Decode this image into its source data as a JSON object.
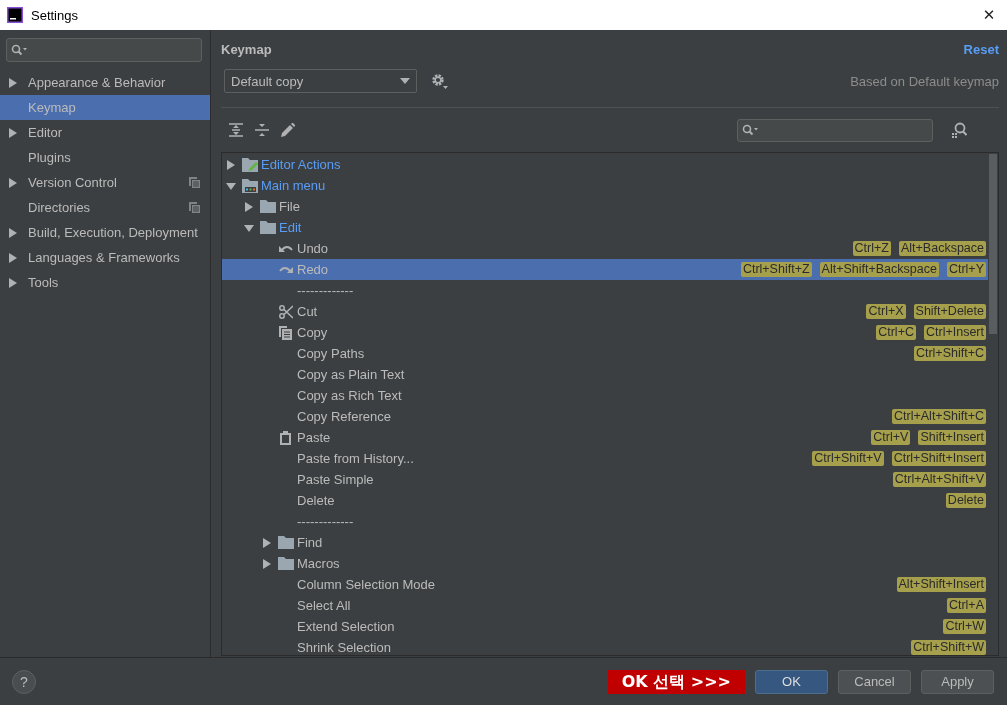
{
  "window": {
    "title": "Settings",
    "close": "✕"
  },
  "sidebar": {
    "items": [
      {
        "label": "Appearance & Behavior",
        "expanded": false,
        "selected": false,
        "project_level": false
      },
      {
        "label": "Keymap",
        "selected": true,
        "project_level": false
      },
      {
        "label": "Editor",
        "expanded": false,
        "selected": false,
        "project_level": false
      },
      {
        "label": "Plugins",
        "selected": false,
        "project_level": false
      },
      {
        "label": "Version Control",
        "expanded": false,
        "selected": false,
        "project_level": true
      },
      {
        "label": "Directories",
        "selected": false,
        "project_level": true
      },
      {
        "label": "Build, Execution, Deployment",
        "expanded": false,
        "selected": false,
        "project_level": false
      },
      {
        "label": "Languages & Frameworks",
        "expanded": false,
        "selected": false,
        "project_level": false
      },
      {
        "label": "Tools",
        "expanded": false,
        "selected": false,
        "project_level": false
      }
    ]
  },
  "keymap": {
    "title": "Keymap",
    "reset": "Reset",
    "scheme": "Default copy",
    "based_on": "Based on Default keymap",
    "tree": [
      {
        "kind": "editor-actions",
        "label": "Editor Actions",
        "expanded": false,
        "modified": true,
        "selected": false
      },
      {
        "kind": "main-menu",
        "label": "Main menu",
        "expanded": true,
        "modified": true,
        "selected": false,
        "children": [
          {
            "kind": "folder",
            "label": "File",
            "expanded": false,
            "modified": false,
            "selected": false
          },
          {
            "kind": "folder",
            "label": "Edit",
            "expanded": true,
            "modified": true,
            "selected": false,
            "children": [
              {
                "kind": "undo",
                "label": "Undo",
                "selected": false,
                "shortcuts": [
                  "Ctrl+Z",
                  "Alt+Backspace"
                ]
              },
              {
                "kind": "redo",
                "label": "Redo",
                "selected": true,
                "shortcuts": [
                  "Ctrl+Shift+Z",
                  "Alt+Shift+Backspace",
                  "Ctrl+Y"
                ]
              },
              {
                "kind": "separator",
                "label": "-------------",
                "selected": false
              },
              {
                "kind": "cut",
                "label": "Cut",
                "selected": false,
                "shortcuts": [
                  "Ctrl+X",
                  "Shift+Delete"
                ]
              },
              {
                "kind": "copy",
                "label": "Copy",
                "selected": false,
                "shortcuts": [
                  "Ctrl+C",
                  "Ctrl+Insert"
                ]
              },
              {
                "kind": "plain",
                "label": "Copy Paths",
                "selected": false,
                "shortcuts": [
                  "Ctrl+Shift+C"
                ]
              },
              {
                "kind": "plain",
                "label": "Copy as Plain Text",
                "selected": false
              },
              {
                "kind": "plain",
                "label": "Copy as Rich Text",
                "selected": false
              },
              {
                "kind": "plain",
                "label": "Copy Reference",
                "selected": false,
                "shortcuts": [
                  "Ctrl+Alt+Shift+C"
                ]
              },
              {
                "kind": "paste",
                "label": "Paste",
                "selected": false,
                "shortcuts": [
                  "Ctrl+V",
                  "Shift+Insert"
                ]
              },
              {
                "kind": "plain",
                "label": "Paste from History...",
                "selected": false,
                "shortcuts": [
                  "Ctrl+Shift+V",
                  "Ctrl+Shift+Insert"
                ]
              },
              {
                "kind": "plain",
                "label": "Paste Simple",
                "selected": false,
                "shortcuts": [
                  "Ctrl+Alt+Shift+V"
                ]
              },
              {
                "kind": "plain",
                "label": "Delete",
                "selected": false,
                "shortcuts": [
                  "Delete"
                ]
              },
              {
                "kind": "separator",
                "label": "-------------",
                "selected": false
              },
              {
                "kind": "folder",
                "label": "Find",
                "expanded": false,
                "modified": false,
                "selected": false
              },
              {
                "kind": "folder",
                "label": "Macros",
                "expanded": false,
                "modified": false,
                "selected": false
              },
              {
                "kind": "plain",
                "label": "Column Selection Mode",
                "selected": false,
                "shortcuts": [
                  "Alt+Shift+Insert"
                ]
              },
              {
                "kind": "plain",
                "label": "Select All",
                "selected": false,
                "shortcuts": [
                  "Ctrl+A"
                ]
              },
              {
                "kind": "plain",
                "label": "Extend Selection",
                "selected": false,
                "shortcuts": [
                  "Ctrl+W"
                ]
              },
              {
                "kind": "plain",
                "label": "Shrink Selection",
                "selected": false,
                "shortcuts": [
                  "Ctrl+Shift+W"
                ]
              }
            ]
          }
        ]
      }
    ]
  },
  "footer": {
    "help": "?",
    "callout": "OK 선택 >>>",
    "buttons": [
      {
        "label": "OK",
        "primary": true
      },
      {
        "label": "Cancel",
        "primary": false
      },
      {
        "label": "Apply",
        "primary": false
      }
    ]
  }
}
